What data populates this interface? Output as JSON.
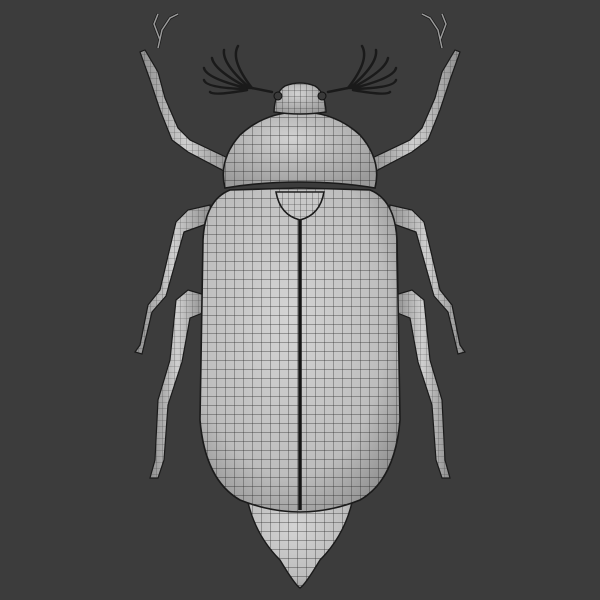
{
  "scene": {
    "subject": "beetle-wireframe-model",
    "view": "top",
    "colors": {
      "background": "#3c3c3c",
      "surface": "#b9b9b9",
      "surface_light": "#d6d6d6",
      "wire": "#222222",
      "outline": "#1a1a1a"
    }
  }
}
